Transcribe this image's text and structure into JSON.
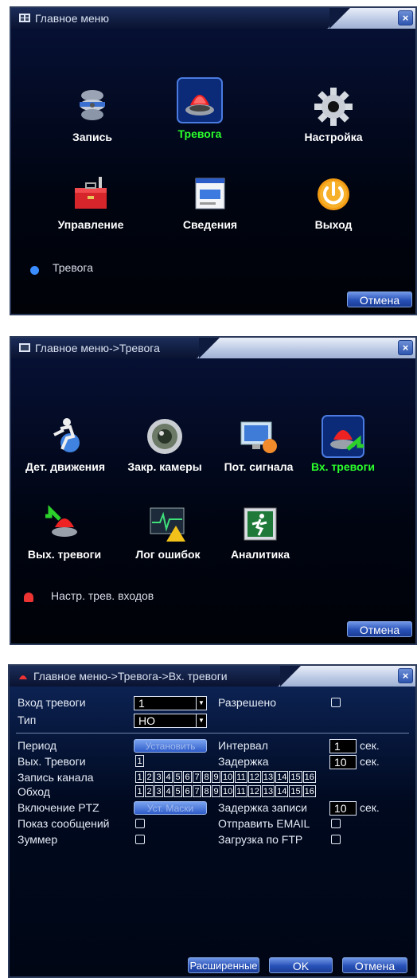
{
  "panel1": {
    "title": "Главное меню",
    "items": [
      {
        "label": "Запись",
        "icon": "film-reel-icon"
      },
      {
        "label": "Тревога",
        "icon": "alarm-siren-icon",
        "selected": true
      },
      {
        "label": "Настройка",
        "icon": "gear-icon"
      },
      {
        "label": "Управление",
        "icon": "toolbox-icon"
      },
      {
        "label": "Сведения",
        "icon": "info-window-icon"
      },
      {
        "label": "Выход",
        "icon": "power-icon"
      }
    ],
    "status": "Тревога",
    "cancel": "Отмена"
  },
  "panel2": {
    "title": "Главное меню->Тревога",
    "items": [
      {
        "label": "Дет. движения",
        "icon": "motion-detect-icon"
      },
      {
        "label": "Закр. камеры",
        "icon": "camera-lens-icon"
      },
      {
        "label": "Пот. сигнала",
        "icon": "video-loss-icon"
      },
      {
        "label": "Вх. тревоги",
        "icon": "alarm-input-icon",
        "selected": true
      },
      {
        "label": "Вых. тревоги",
        "icon": "alarm-output-icon"
      },
      {
        "label": "Лог ошибок",
        "icon": "error-log-icon"
      },
      {
        "label": "Аналитика",
        "icon": "analytics-icon"
      }
    ],
    "status": "Настр. трев. входов",
    "cancel": "Отмена"
  },
  "panel3": {
    "title": "Главное меню->Тревога->Вх. тревоги",
    "alarm_input_label": "Вход тревоги",
    "alarm_input_value": "1",
    "enabled_label": "Разрешено",
    "type_label": "Тип",
    "type_value": "НО",
    "period_label": "Период",
    "period_button": "Установить",
    "interval_label": "Интервал",
    "interval_value": "1",
    "sec": "сек.",
    "out_label": "Вых. Тревоги",
    "out_value": "1",
    "delay_label": "Задержка",
    "delay_value": "10",
    "record_label": "Запись канала",
    "tour_label": "Обход",
    "channels": [
      "1",
      "2",
      "3",
      "4",
      "5",
      "6",
      "7",
      "8",
      "9",
      "10",
      "11",
      "12",
      "13",
      "14",
      "15",
      "16"
    ],
    "ptz_label": "Включение PTZ",
    "ptz_button": "Уст. Маски",
    "rec_delay_label": "Задержка записи",
    "rec_delay_value": "10",
    "show_msg_label": "Показ сообщений",
    "email_label": "Отправить EMAIL",
    "buzzer_label": "Зуммер",
    "ftp_label": "Загрузка по FTP",
    "advanced_button": "Расширенные",
    "ok_button": "OK",
    "cancel_button": "Отмена"
  },
  "colors": {
    "selected": "#2bff2b",
    "text": "#ffffff",
    "accent": "#2851b8"
  }
}
